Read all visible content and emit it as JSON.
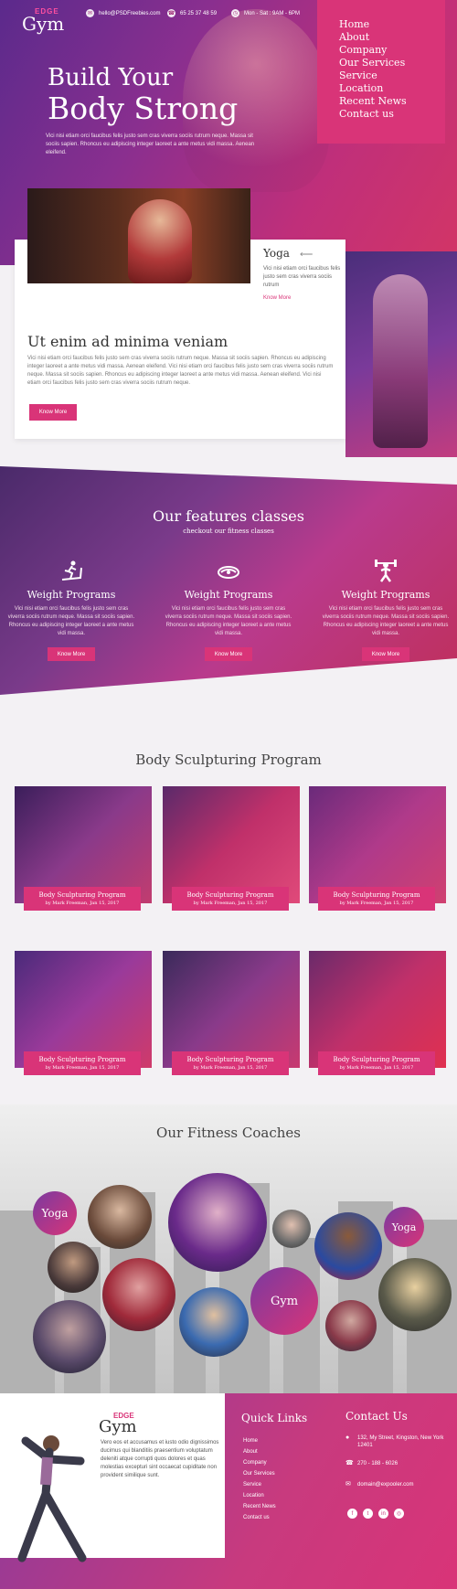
{
  "brand": {
    "edge": "EDGE",
    "gym": "Gym"
  },
  "topbar": {
    "email": "hello@PSDFreebies.com",
    "phone": "65 25 37 48 59",
    "hours": "Mon - Sat : 9AM - 6PM"
  },
  "nav": [
    "Home",
    "About",
    "Company",
    "Our Services",
    "Service",
    "Location",
    "Recent News",
    "Contact us"
  ],
  "hero": {
    "line1": "Build Your",
    "line2": "Body Strong",
    "desc": "Vici nisi etiam orci faucibus felis justo sem cras viverra sociis rutrum neque. Massa sit sociis sapien. Rhoncus eu adipiscing integer laoreet a ante metus vidi massa. Aenean eleifend."
  },
  "yoga": {
    "title": "Yoga",
    "desc": "Vici nisi etiam orci faucibus felis justo sem cras viverra sociis rutrum",
    "more": "Know More"
  },
  "intro": {
    "title": "Ut enim ad minima veniam",
    "desc": "Vici nisi etiam orci faucibus felis justo sem cras viverra sociis rutrum neque. Massa sit sociis sapien. Rhoncus eu adipiscing integer laoreet a ante metus vidi massa. Aenean eleifend. Vici nisi etiam orci faucibus felis justo sem cras viverra sociis rutrum neque. Massa sit sociis sapien. Rhoncus eu adipiscing integer laoreet a ante metus vidi massa. Aenean eleifend. Vici nisi etiam orci faucibus felis justo sem cras viverra sociis rutrum neque.",
    "button": "Know More"
  },
  "features": {
    "title": "Our features classes",
    "subtitle": "checkout our fitness classes",
    "items": [
      {
        "icon": "treadmill-icon",
        "title": "Weight Programs",
        "desc": "Vici nisi etiam orci faucibus felis justo sem cras viverra sociis rutrum neque. Massa sit sociis sapien. Rhoncus eu adipiscing integer laoreet a ante metus vidi massa.",
        "button": "Know More"
      },
      {
        "icon": "yoga-mat-icon",
        "title": "Weight Programs",
        "desc": "Vici nisi etiam orci faucibus felis justo sem cras viverra sociis rutrum neque. Massa sit sociis sapien. Rhoncus eu adipiscing integer laoreet a ante metus vidi massa.",
        "button": "Know More"
      },
      {
        "icon": "weightlifter-icon",
        "title": "Weight Programs",
        "desc": "Vici nisi etiam orci faucibus felis justo sem cras viverra sociis rutrum neque. Massa sit sociis sapien. Rhoncus eu adipiscing integer laoreet a ante metus vidi massa.",
        "button": "Know More"
      }
    ]
  },
  "programs": {
    "title": "Body Sculpturing Program",
    "items": [
      {
        "title": "Body Sculpturing Program",
        "by": "by Mark Freeman, Jan 15, 2017"
      },
      {
        "title": "Body Sculpturing Program",
        "by": "by Mark Freeman, Jan 15, 2017"
      },
      {
        "title": "Body Sculpturing Program",
        "by": "by Mark Freeman, Jan 15, 2017"
      },
      {
        "title": "Body Sculpturing Program",
        "by": "by Mark Freeman, Jan 15, 2017"
      },
      {
        "title": "Body Sculpturing Program",
        "by": "by Mark Freeman, Jan 15, 2017"
      },
      {
        "title": "Body Sculpturing Program",
        "by": "by Mark Freeman, Jan 15, 2017"
      }
    ]
  },
  "coaches": {
    "title": "Our Fitness Coaches",
    "label_yoga": "Yoga",
    "label_gym": "Gym"
  },
  "footer": {
    "desc": "Vero eos et accusamus et iusto odio dignissimos ducimus qui blanditiis praesentium voluptatum deleniti atque corrupti quos dolores et quas molestias excepturi sint occaecat cupiditate non provident similique sunt.",
    "quick_links_title": "Quick Links",
    "quick_links": [
      "Home",
      "About",
      "Company",
      "Our Services",
      "Service",
      "Location",
      "Recent News",
      "Contact us"
    ],
    "contact_title": "Contact Us",
    "address": "132, My Street, Kingston, New York 12401",
    "phone": "270 - 188 - 6026",
    "email": "domain@expooler.com",
    "social": [
      "facebook-icon",
      "twitter-icon",
      "linkedin-icon",
      "dribbble-icon"
    ]
  },
  "colors": {
    "accent": "#d93478",
    "purple": "#7a3aa0"
  }
}
